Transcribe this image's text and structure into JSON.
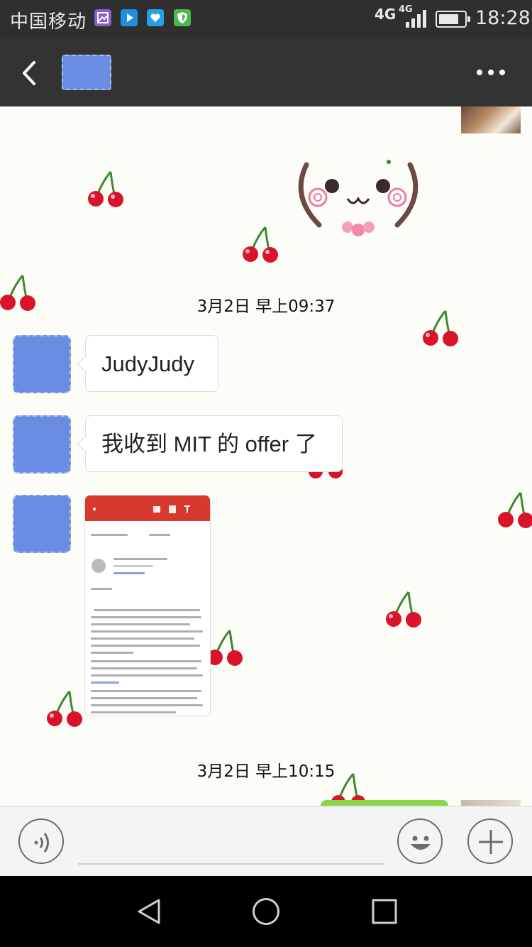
{
  "status_bar": {
    "carrier": "中国移动",
    "network": "4G",
    "network_small": "4G",
    "time": "18:28",
    "battery_level": 0.8,
    "notification_icons": [
      "gallery-icon",
      "video-player-icon",
      "heart-app-icon",
      "shield-app-icon"
    ]
  },
  "header": {
    "back_icon": "chevron-left-icon",
    "more_icon": "more-dots-icon"
  },
  "chat": {
    "timestamps": [
      "3月2日 早上09:37",
      "3月2日 早上10:15"
    ],
    "messages": [
      {
        "sender": "contact",
        "type": "text",
        "text": "JudyJudy"
      },
      {
        "sender": "contact",
        "type": "text",
        "text": "我收到 MIT 的 offer 了"
      },
      {
        "sender": "contact",
        "type": "image",
        "image": "offer-email-screenshot"
      }
    ]
  },
  "input_bar": {
    "voice_icon": "voice-icon",
    "emoji_icon": "emoji-icon",
    "plus_icon": "plus-icon",
    "placeholder": ""
  },
  "colors": {
    "status_bar_bg": "#2f2f2f",
    "title_bar_bg": "#333333",
    "chat_bg": "#fdfdf7",
    "bubble_bg": "#ffffff",
    "cherry_red": "#d9142a",
    "email_header_red": "#d8392f",
    "outgoing_bubble": "#8bd54d"
  }
}
